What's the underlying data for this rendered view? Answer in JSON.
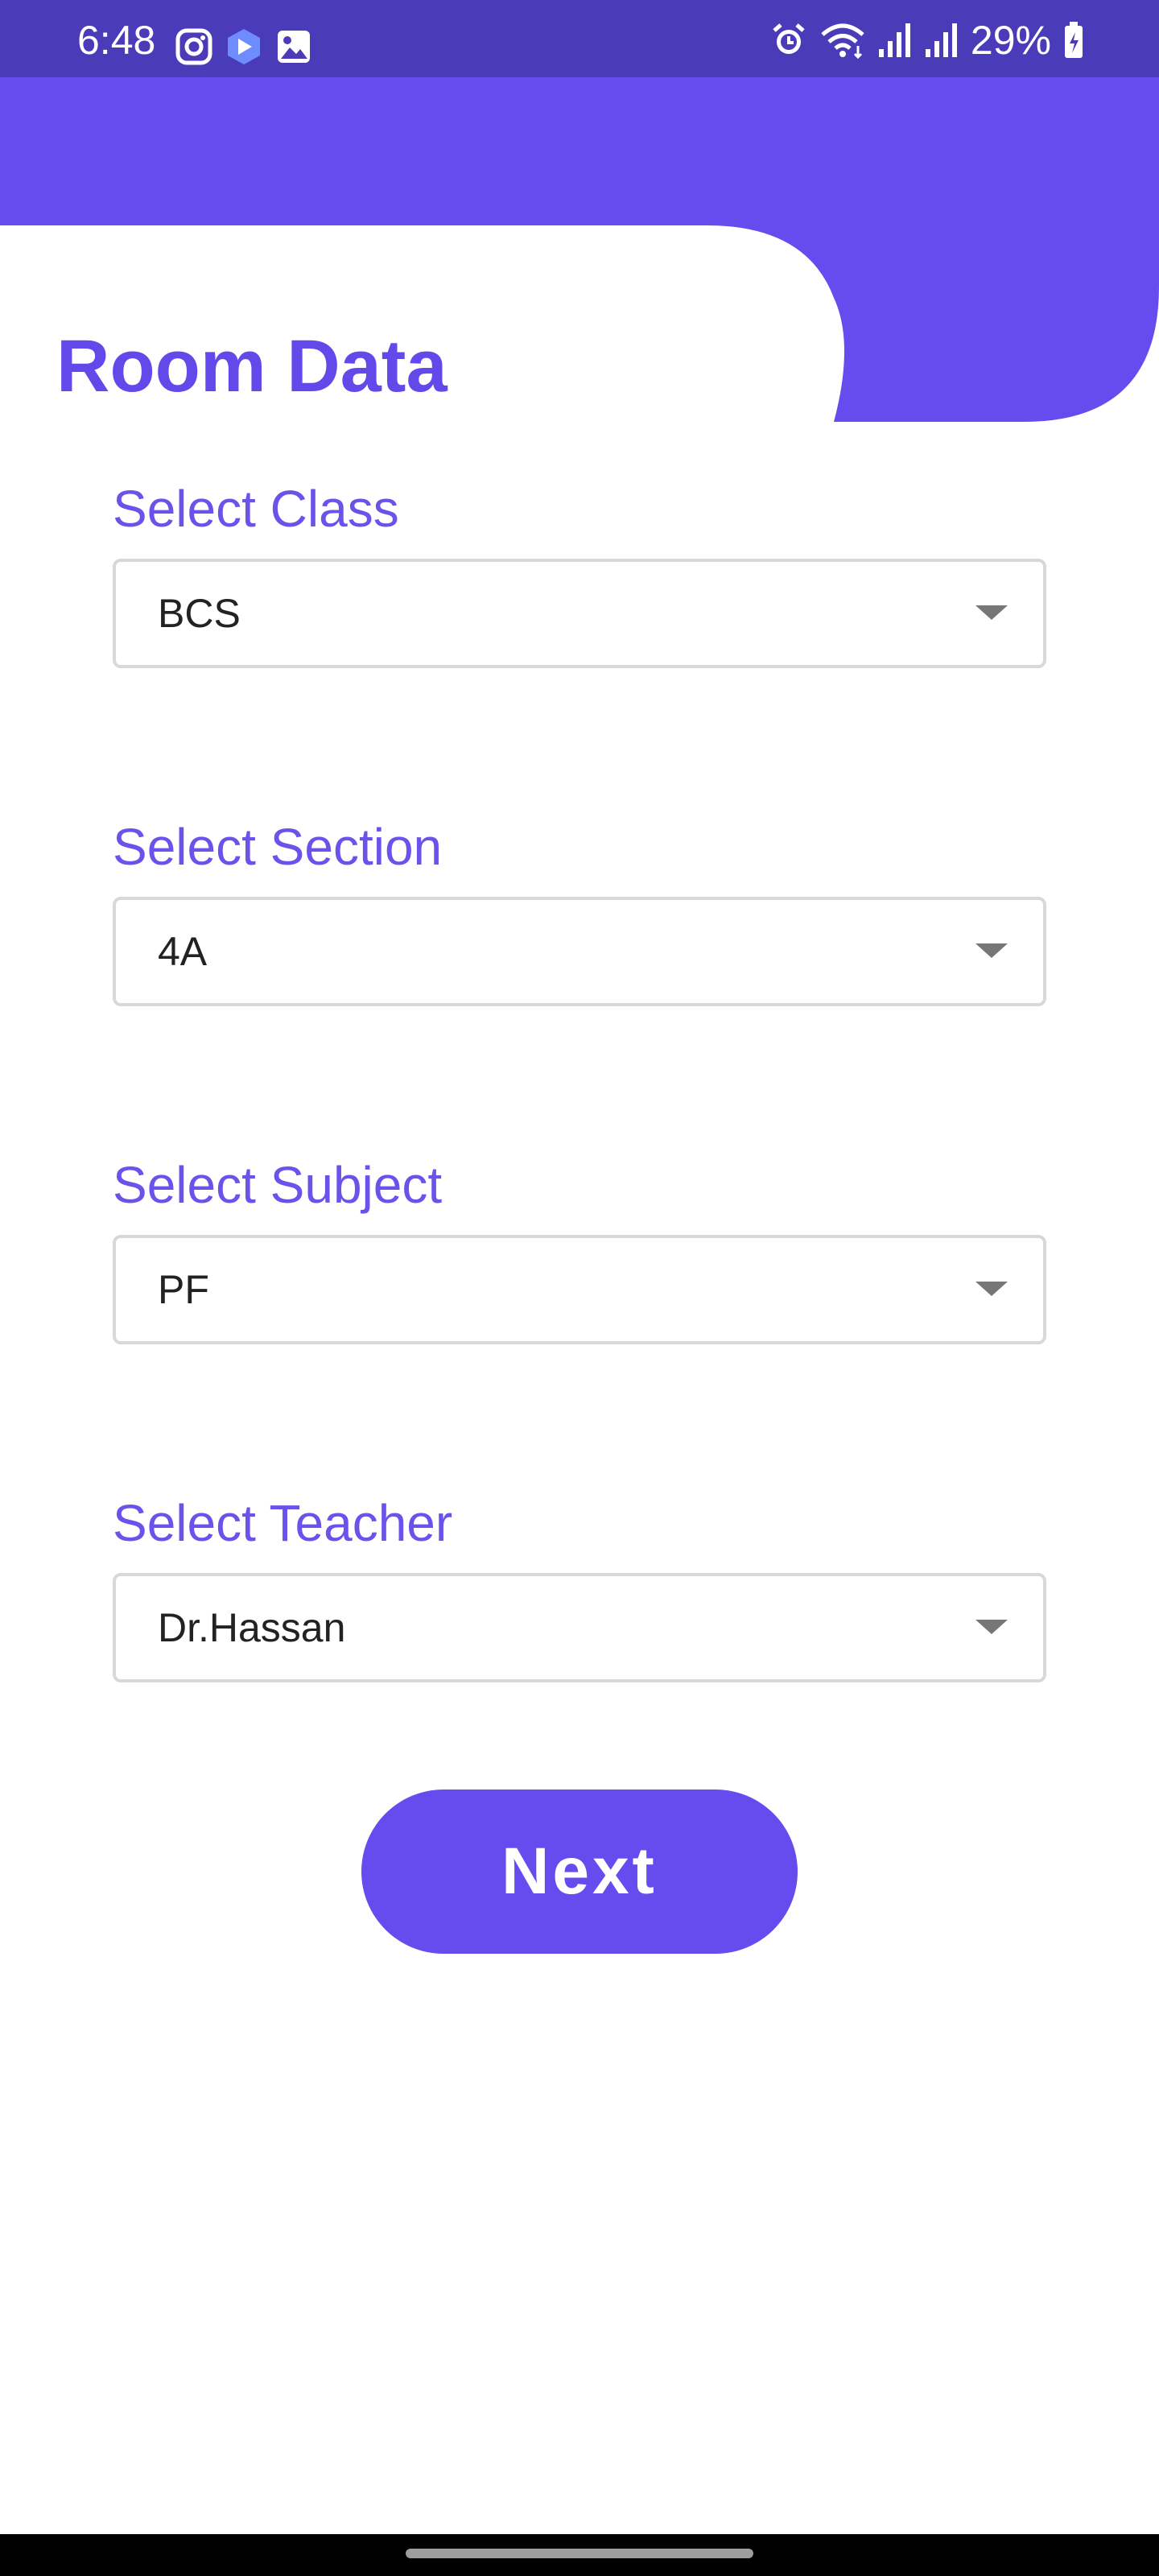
{
  "status_bar": {
    "time": "6:48",
    "battery": "29%",
    "left_icons": [
      "instagram-icon",
      "app-icon",
      "gallery-icon"
    ],
    "right_icons": [
      "alarm-icon",
      "wifi-icon",
      "signal-icon",
      "signal-icon",
      "battery-icon"
    ]
  },
  "header": {
    "title": "Room Data"
  },
  "form": {
    "fields": [
      {
        "label": "Select Class",
        "value": "BCS"
      },
      {
        "label": "Select Section",
        "value": "4A"
      },
      {
        "label": "Select Subject",
        "value": "PF"
      },
      {
        "label": "Select Teacher",
        "value": "Dr.Hassan"
      }
    ],
    "next_label": "Next"
  },
  "colors": {
    "status_bar": "#4a3bb9",
    "primary": "#664cef",
    "label": "#6a52ea",
    "select_border": "#d8d8d8",
    "nav_bar": "#000000"
  }
}
